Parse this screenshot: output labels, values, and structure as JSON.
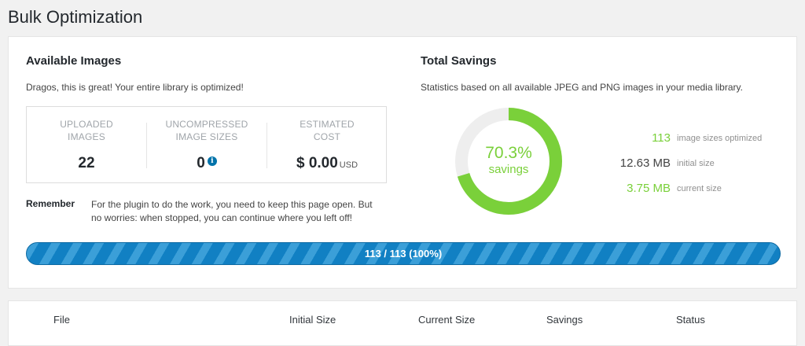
{
  "page": {
    "title": "Bulk Optimization"
  },
  "available": {
    "heading": "Available Images",
    "message": "Dragos, this is great! Your entire library is optimized!",
    "stats": [
      {
        "label": "UPLOADED IMAGES",
        "value": "22"
      },
      {
        "label": "UNCOMPRESSED IMAGE SIZES",
        "value": "0"
      },
      {
        "label": "ESTIMATED COST",
        "value": "$ 0.00",
        "unit": "USD"
      }
    ],
    "remember_label": "Remember",
    "remember_text": "For the plugin to do the work, you need to keep this page open. But no worries: when stopped, you can continue where you left off!"
  },
  "savings": {
    "heading": "Total Savings",
    "description": "Statistics based on all available JPEG and PNG images in your media library.",
    "percent": 70.3,
    "percent_text": "70.3%",
    "percent_label": "savings",
    "ring_color": "#7ad03a",
    "ring_track_color": "#eeeeee",
    "rows": [
      {
        "value": "113",
        "label": "image sizes optimized",
        "color": "#7ad03a"
      },
      {
        "value": "12.63 MB",
        "label": "initial size",
        "color": "#444444"
      },
      {
        "value": "3.75 MB",
        "label": "current size",
        "color": "#7ad03a"
      }
    ]
  },
  "progress": {
    "done": 113,
    "total": 113,
    "text": "113 / 113 (100%)",
    "color": "#1180c3"
  },
  "table": {
    "columns": [
      "File",
      "Initial Size",
      "Current Size",
      "Savings",
      "Status"
    ]
  },
  "icons": {
    "info": "info-icon"
  }
}
